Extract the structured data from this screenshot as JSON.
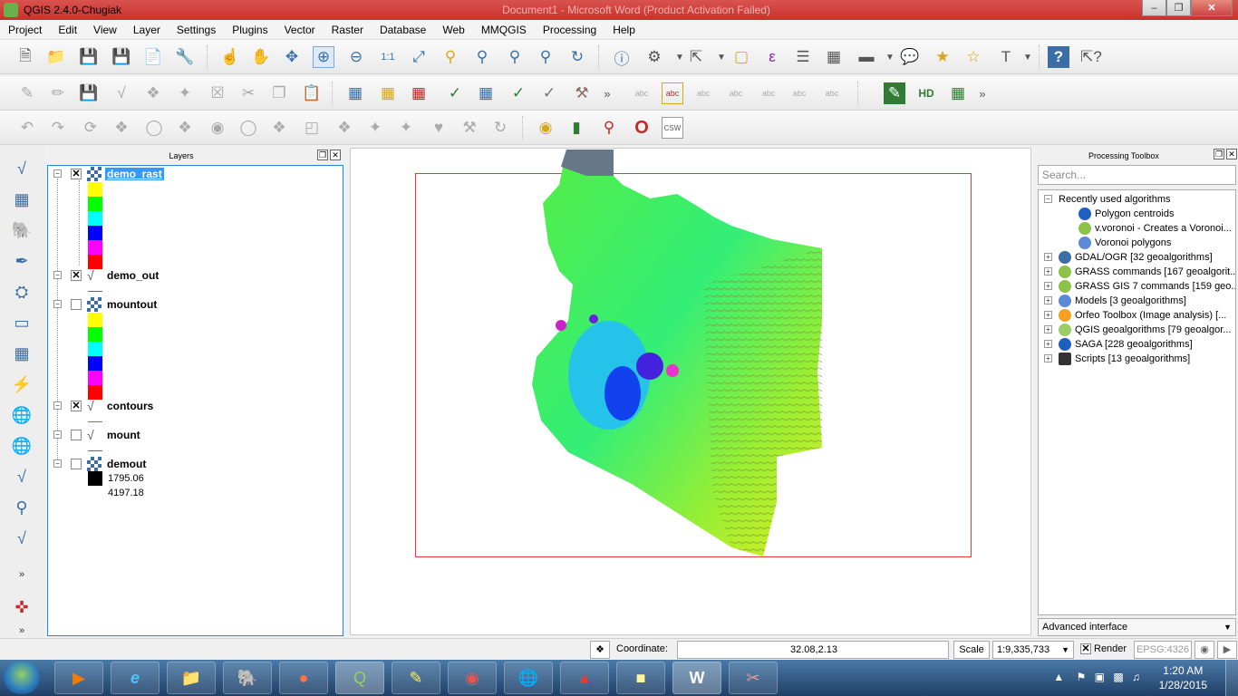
{
  "window": {
    "title": "QGIS 2.4.0-Chugiak",
    "background_title": "Document1 - Microsoft Word (Product Activation Failed)"
  },
  "menu": [
    "Project",
    "Edit",
    "View",
    "Layer",
    "Settings",
    "Plugins",
    "Vector",
    "Raster",
    "Database",
    "Web",
    "MMQGIS",
    "Processing",
    "Help"
  ],
  "layers_panel": {
    "title": "Layers",
    "layers": [
      {
        "name": "demo_rast",
        "type": "raster",
        "checked": true,
        "selected": true
      },
      {
        "name": "demo_out",
        "type": "vector",
        "checked": true
      },
      {
        "name": "mountout",
        "type": "raster",
        "checked": false
      },
      {
        "name": "contours",
        "type": "vector",
        "checked": true
      },
      {
        "name": "mount",
        "type": "vector",
        "checked": false
      },
      {
        "name": "demout",
        "type": "raster",
        "checked": false,
        "legend_min": "1795.06",
        "legend_max": "4197.18"
      }
    ],
    "legend_colors": [
      "#ffff00",
      "#00ff00",
      "#00ffff",
      "#0000ff",
      "#ff00ff",
      "#ff0000"
    ]
  },
  "processing": {
    "title": "Processing Toolbox",
    "search_placeholder": "Search...",
    "recent_label": "Recently used algorithms",
    "recent": [
      "Polygon centroids",
      "v.voronoi - Creates a Voronoi...",
      "Voronoi polygons"
    ],
    "providers": [
      "GDAL/OGR [32 geoalgorithms]",
      "GRASS commands [167 geoalgorit...",
      "GRASS GIS 7 commands [159 geo...",
      "Models [3 geoalgorithms]",
      "Orfeo Toolbox (Image analysis) [...",
      "QGIS geoalgorithms [79 geoalgor...",
      "SAGA [228 geoalgorithms]",
      "Scripts [13 geoalgorithms]"
    ],
    "advanced": "Advanced interface"
  },
  "statusbar": {
    "coordinate_label": "Coordinate:",
    "coordinate_value": "32.08,2.13",
    "scale_label": "Scale",
    "scale_value": "1:9,335,733",
    "render_label": "Render",
    "crs": "EPSG:4326"
  },
  "toolbar_icons": {
    "csw": "CSW",
    "abc": "abc"
  },
  "taskbar": {
    "time": "1:20 AM",
    "date": "1/28/2015"
  },
  "colors": {
    "selected": "#3399ff",
    "extent": "#e53935",
    "panel_border": "#1e88e5"
  }
}
